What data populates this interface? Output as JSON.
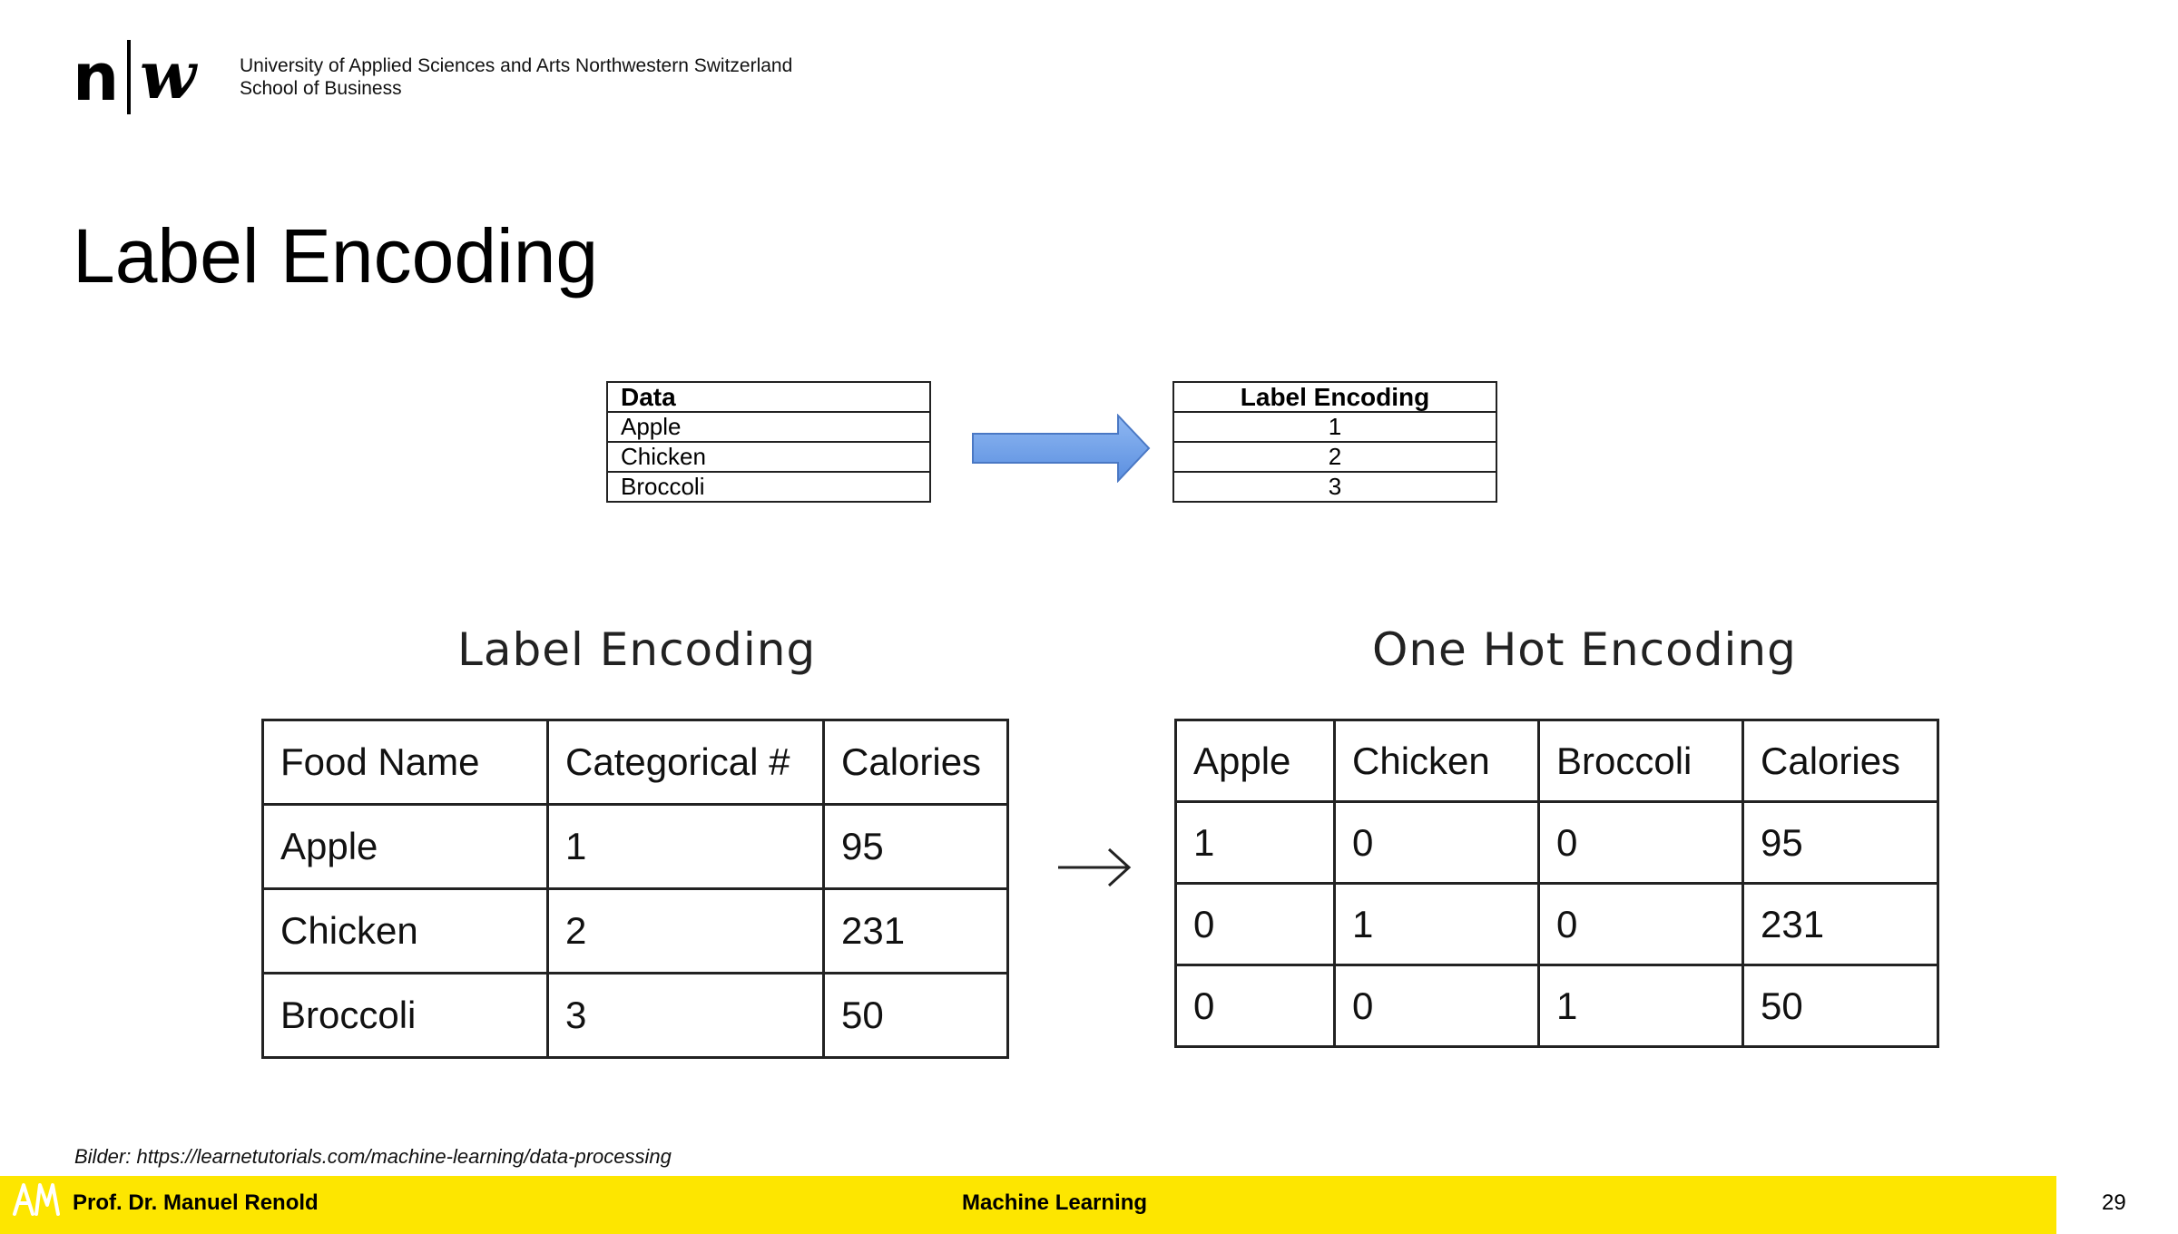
{
  "header": {
    "logo_n": "n",
    "logo_w": "w",
    "university_line1": "University of Applied Sciences and Arts Northwestern Switzerland",
    "university_line2": "School of Business"
  },
  "title": "Label Encoding",
  "top_left_table": {
    "header": "Data",
    "rows": [
      "Apple",
      "Chicken",
      "Broccoli"
    ]
  },
  "top_right_table": {
    "header": "Label Encoding",
    "rows": [
      "1",
      "2",
      "3"
    ]
  },
  "label_encoding": {
    "title": "Label Encoding",
    "columns": [
      "Food Name",
      "Categorical #",
      "Calories"
    ],
    "rows": [
      [
        "Apple",
        "1",
        "95"
      ],
      [
        "Chicken",
        "2",
        "231"
      ],
      [
        "Broccoli",
        "3",
        "50"
      ]
    ]
  },
  "one_hot_encoding": {
    "title": "One Hot Encoding",
    "columns": [
      "Apple",
      "Chicken",
      "Broccoli",
      "Calories"
    ],
    "rows": [
      [
        "1",
        "0",
        "0",
        "95"
      ],
      [
        "0",
        "1",
        "0",
        "231"
      ],
      [
        "0",
        "0",
        "1",
        "50"
      ]
    ]
  },
  "credit": "Bilder: https://learnetutorials.com/machine-learning/data-processing",
  "footer": {
    "logo_text": "AM",
    "author": "Prof. Dr. Manuel Renold",
    "course": "Machine Learning",
    "page_number": "29",
    "color": "#fde600"
  },
  "arrow_color": "#6f9fe8"
}
